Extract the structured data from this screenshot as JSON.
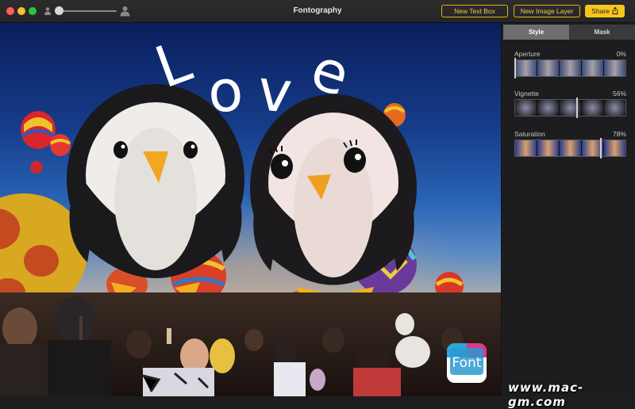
{
  "window": {
    "title": "Fontography"
  },
  "toolbar": {
    "new_text_box": "New Text Box",
    "new_image_layer": "New Image Layer",
    "share": "Share",
    "zoom_level": 0
  },
  "canvas": {
    "love_letters": [
      "L",
      "o",
      "v",
      "e"
    ],
    "logo_text": "Font",
    "watermark": "www.mac-gm.com"
  },
  "panel": {
    "tabs": [
      {
        "label": "Style",
        "active": true
      },
      {
        "label": "Mask",
        "active": false
      }
    ],
    "controls": [
      {
        "label": "Aperture",
        "value": "0%",
        "level": 0
      },
      {
        "label": "Vignette",
        "value": "56%",
        "level": 0.56
      },
      {
        "label": "Saturation",
        "value": "78%",
        "level": 0.78
      }
    ]
  },
  "colors": {
    "accent": "#f6c61e",
    "panel_bg": "#1d1d1f",
    "titlebar_bg": "#2c2c2e"
  },
  "icons": {
    "close": "close-dot-icon",
    "minimize": "minimize-dot-icon",
    "maximize": "maximize-dot-icon",
    "person_small": "person-small-icon",
    "person_large": "person-large-icon",
    "share": "share-icon"
  }
}
